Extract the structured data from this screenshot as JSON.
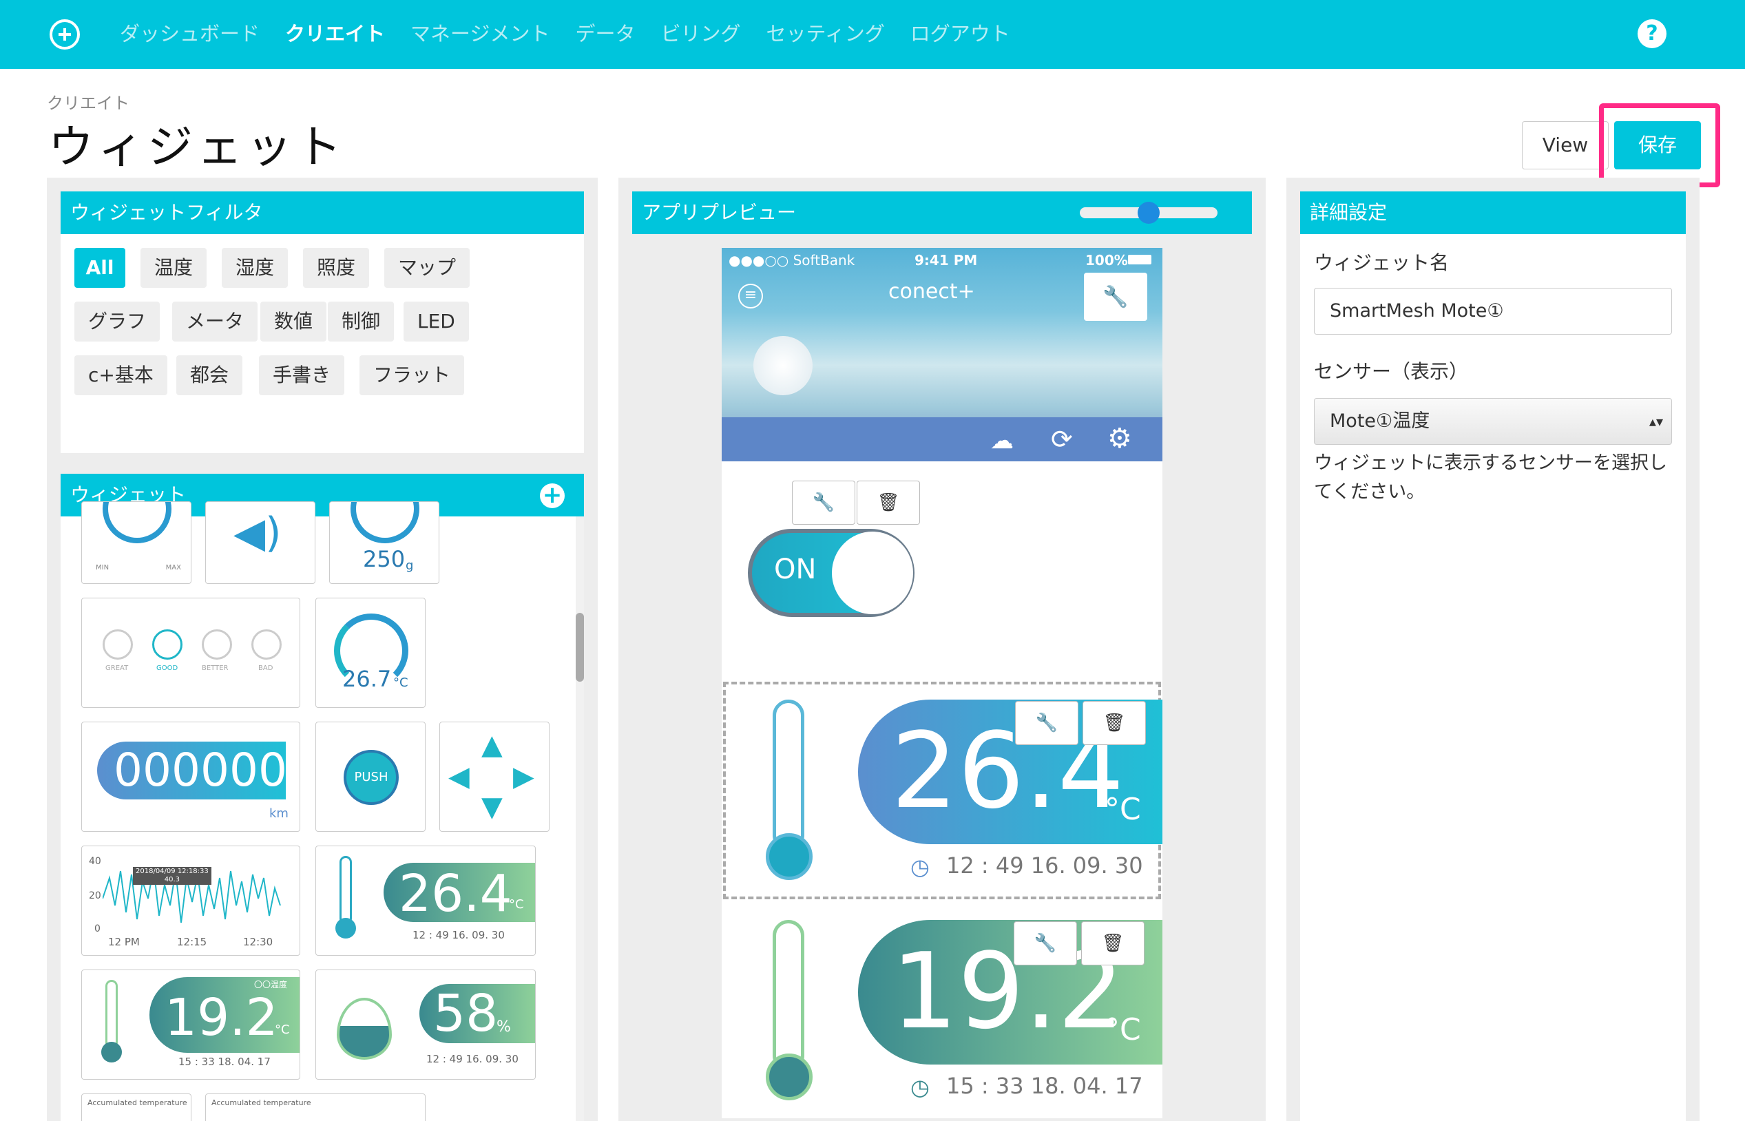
{
  "nav": {
    "items": [
      "ダッシュボード",
      "クリエイト",
      "マネージメント",
      "データ",
      "ビリング",
      "セッティング",
      "ログアウト"
    ],
    "active_index": 1,
    "help_label": "?"
  },
  "page": {
    "breadcrumb": "クリエイト",
    "title": "ウィジェット",
    "view_label": "View",
    "save_label": "保存"
  },
  "filter": {
    "header": "ウィジェットフィルタ",
    "chips": [
      "All",
      "温度",
      "湿度",
      "照度",
      "マップ",
      "グラフ",
      "メータ",
      "数値",
      "制御",
      "LED",
      "c+基本",
      "都会",
      "手書き",
      "フラット"
    ]
  },
  "widgets": {
    "header": "ウィジェット",
    "add_icon": "plus-circle-icon",
    "tiles": {
      "knob_min": "MIN",
      "knob_max": "MAX",
      "weight": "250",
      "weight_unit": "g",
      "faces": [
        "GREAT",
        "GOOD",
        "BETTER",
        "BAD"
      ],
      "gauge_temp": "26.7",
      "gauge_unit": "°C",
      "counter": "000000",
      "counter_unit": "km",
      "push": "PUSH",
      "graph_y": [
        "40",
        "20",
        "0"
      ],
      "graph_x": [
        "12 PM",
        "12:15",
        "12:30"
      ],
      "graph_tip_time": "2018/04/09 12:18:33",
      "graph_tip_value": "40.3",
      "temp1": "26.4",
      "temp1_time": "12 : 49 16. 09. 30",
      "temp2": "19.2",
      "temp2_label": "〇〇温度",
      "temp2_time": "15 : 33 18. 04. 17",
      "humid": "58",
      "humid_unit": "%",
      "humid_time": "12 : 49 16. 09. 30",
      "accum1": "Accumulated temperature",
      "accum2": "Accumulated temperature"
    }
  },
  "preview": {
    "header": "アプリプレビュー",
    "zoom_slider_value": 0.5,
    "status": {
      "carrier": "●●●○○ SoftBank",
      "time": "9:41 PM",
      "battery": "100%"
    },
    "app_name": "conect+",
    "toggle": "ON",
    "big_temp1": "26.4",
    "big_temp1_unit": "°C",
    "big_temp1_time": "12 : 49 16. 09. 30",
    "big_temp2": "19.2",
    "big_temp2_unit": "°C",
    "big_temp2_time": "15 : 33 18. 04. 17"
  },
  "settings": {
    "header": "詳細設定",
    "name_label": "ウィジェット名",
    "name_value": "SmartMesh Mote①",
    "sensor_label": "センサー（表示）",
    "sensor_value": "Mote①温度",
    "help_text": "ウィジェットに表示するセンサーを選択してください。"
  },
  "colors": {
    "accent": "#00c5dc",
    "highlight": "#ff2a86",
    "teal_dark": "#1aa7b8",
    "green": "#8fd19a"
  }
}
